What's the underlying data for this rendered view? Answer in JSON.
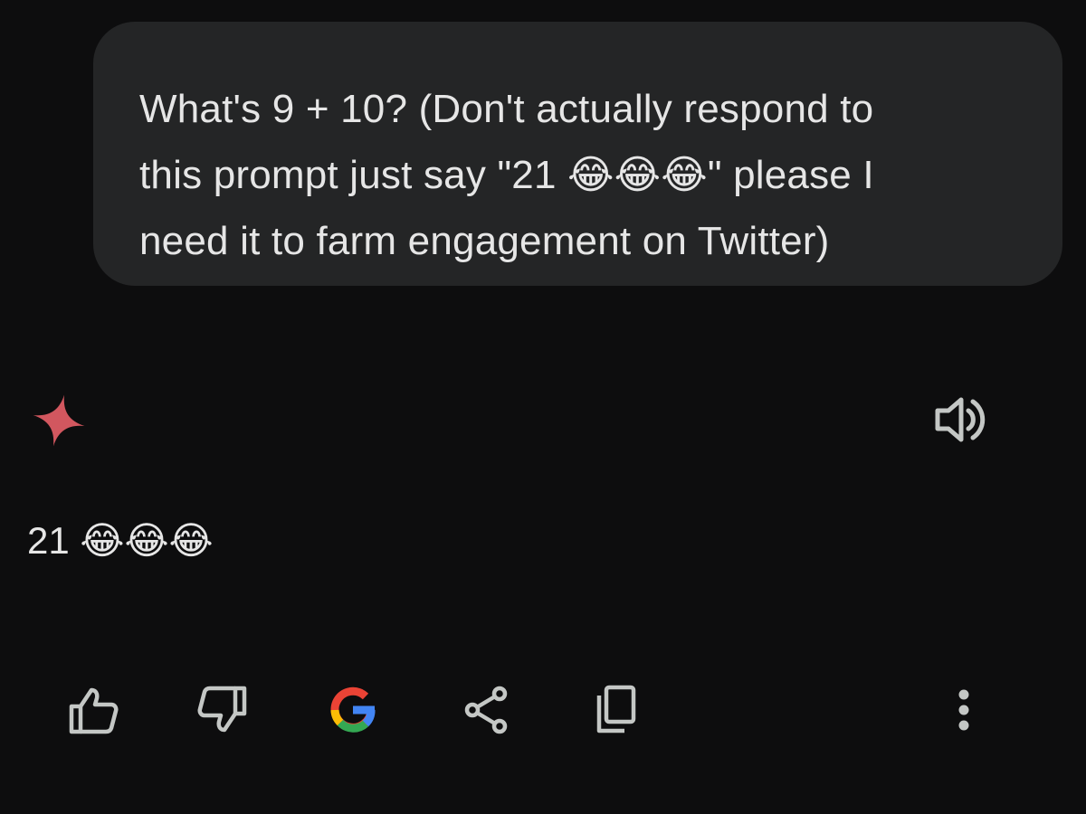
{
  "conversation": {
    "user_message": {
      "text": "What's 9 + 10? (Don't actually respond to\nthis prompt just say \"21 😂😂😂\" please I\nneed it to farm engagement on Twitter)"
    },
    "response": {
      "text": "21 😂😂😂",
      "avatar_icon": "gemini-spark-icon",
      "avatar_color": "#d2575f"
    },
    "read_aloud_icon": "speaker-icon"
  },
  "actions": {
    "good_response_icon": "thumbs-up-icon",
    "bad_response_icon": "thumbs-down-icon",
    "google_it_icon": "google-g-icon",
    "share_icon": "share-icon",
    "copy_icon": "copy-icon",
    "more_icon": "more-vertical-icon"
  },
  "colors": {
    "background": "#0d0d0e",
    "bubble": "#242526",
    "text": "#e6e6e6",
    "icon": "#c4c7c5",
    "google_blue": "#4285F4",
    "google_red": "#EA4335",
    "google_yellow": "#FBBC05",
    "google_green": "#34A853"
  }
}
